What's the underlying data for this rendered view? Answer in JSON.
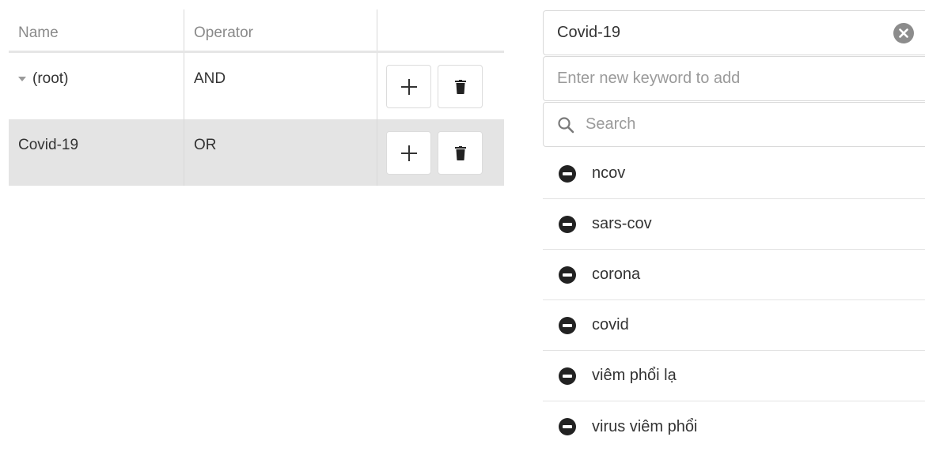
{
  "grid": {
    "columns": {
      "name": "Name",
      "operator": "Operator"
    },
    "rows": [
      {
        "name": "(root)",
        "operator": "AND",
        "expanded": true
      },
      {
        "name": "Covid-19",
        "operator": "OR",
        "selected": true
      }
    ],
    "add_button_icon": "plus-icon",
    "delete_button_icon": "trash-icon"
  },
  "panel": {
    "group_name": "Covid-19",
    "new_keyword_placeholder": "Enter new keyword to add",
    "search_placeholder": "Search",
    "keywords": [
      "ncov",
      "sars-cov",
      "corona",
      "covid",
      "viêm phổi lạ",
      "virus viêm phổi"
    ],
    "remove_icon": "minus-circle-icon",
    "clear_icon": "clear-circle-icon"
  }
}
